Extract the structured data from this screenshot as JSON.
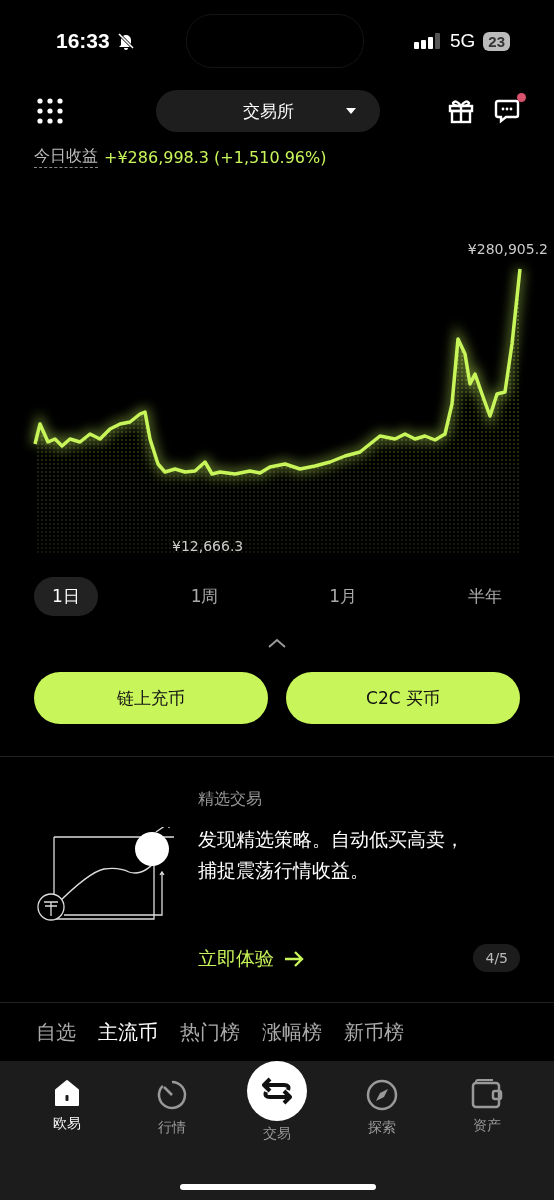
{
  "status_bar": {
    "time": "16:33",
    "network": "5G",
    "battery": "23"
  },
  "header": {
    "exchange_selector": "交易所",
    "messages_unread": true
  },
  "profit": {
    "label": "今日收益",
    "value": "+¥286,998.3 (+1,510.96%)"
  },
  "chart": {
    "max_label": "¥280,905.2",
    "min_label": "¥12,666.3"
  },
  "range_tabs": [
    {
      "label": "1日",
      "selected": true
    },
    {
      "label": "1周",
      "selected": false
    },
    {
      "label": "1月",
      "selected": false
    },
    {
      "label": "半年",
      "selected": false
    }
  ],
  "actions": [
    "链上充币",
    "C2C 买币"
  ],
  "promo": {
    "title": "精选交易",
    "text": "发现精选策略。自动低买高卖，捕捉震荡行情收益。",
    "link": "立即体验",
    "pager": "4/5"
  },
  "market_tabs": [
    {
      "label": "自选",
      "selected": false
    },
    {
      "label": "主流币",
      "selected": true
    },
    {
      "label": "热门榜",
      "selected": false
    },
    {
      "label": "涨幅榜",
      "selected": false
    },
    {
      "label": "新币榜",
      "selected": false
    }
  ],
  "nav": [
    {
      "label": "欧易",
      "kind": "home",
      "selected": true
    },
    {
      "label": "行情",
      "kind": "market",
      "selected": false
    },
    {
      "label": "交易",
      "kind": "trade",
      "selected": false
    },
    {
      "label": "探索",
      "kind": "explore",
      "selected": false
    },
    {
      "label": "资产",
      "kind": "wallet",
      "selected": false
    }
  ]
}
